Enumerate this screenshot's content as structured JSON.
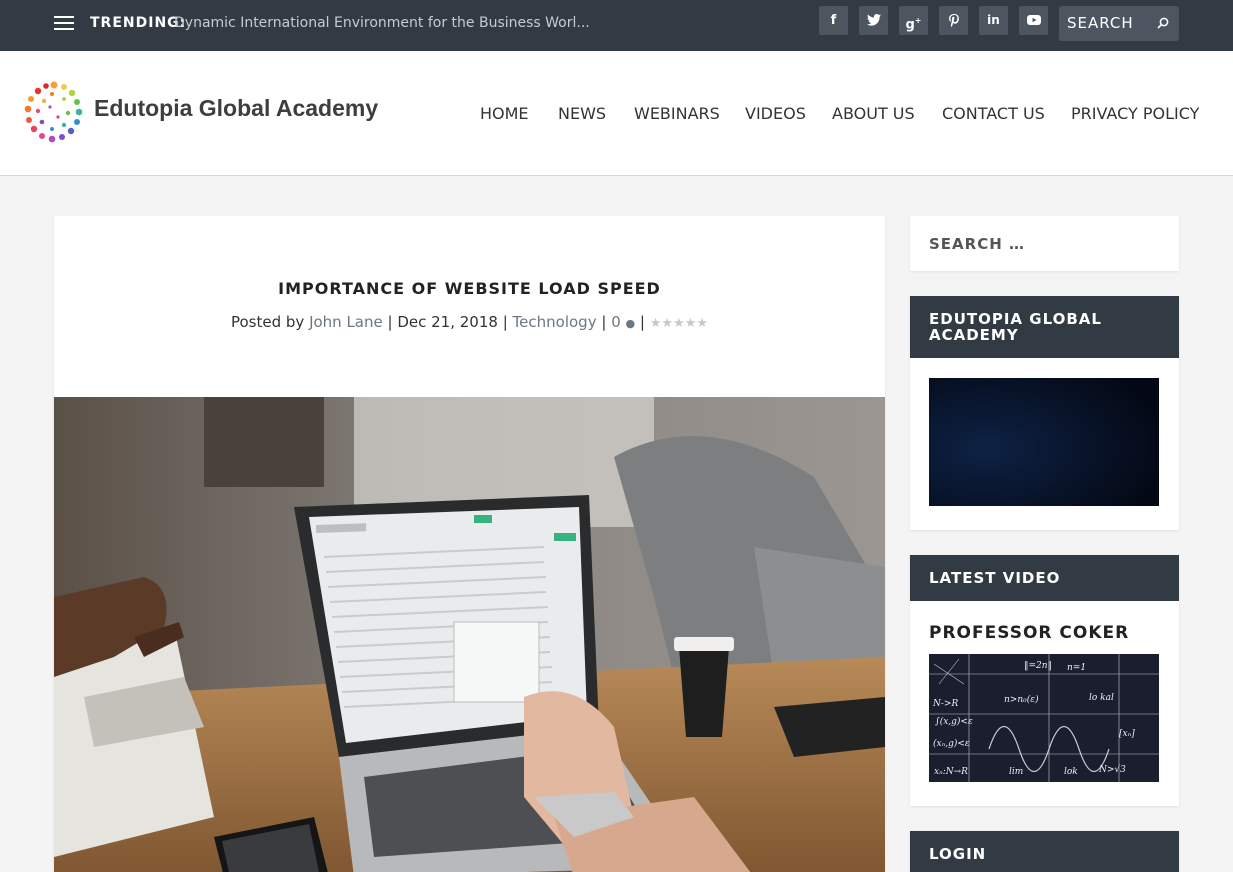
{
  "topbar": {
    "trending_label": "TRENDING:",
    "trending_text": "Dynamic International Environment for the Business Worl...",
    "social": [
      "facebook-icon",
      "twitter-icon",
      "google-plus-icon",
      "pinterest-icon",
      "linkedin-icon",
      "youtube-icon"
    ],
    "search_placeholder": "SEARCH"
  },
  "header": {
    "brand": "Edutopia Global Academy",
    "nav": [
      "HOME",
      "NEWS",
      "WEBINARS",
      "VIDEOS",
      "ABOUT US",
      "CONTACT US",
      "PRIVACY POLICY"
    ]
  },
  "post": {
    "title": "IMPORTANCE OF WEBSITE LOAD SPEED",
    "posted_by": "Posted by",
    "author": "John Lane",
    "date": "Dec 21, 2018",
    "category": "Technology",
    "comments": "0",
    "rating": 0
  },
  "sidebar": {
    "search_placeholder": "SEARCH …",
    "widget1_title": "EDUTOPIA GLOBAL ACADEMY",
    "widget2_title": "LATEST VIDEO",
    "video_title": "PROFESSOR COKER",
    "widget3_title": "LOGIN"
  },
  "colors": {
    "topbar": "#323b44",
    "link": "#6b7782",
    "background": "#f4f4f4"
  }
}
